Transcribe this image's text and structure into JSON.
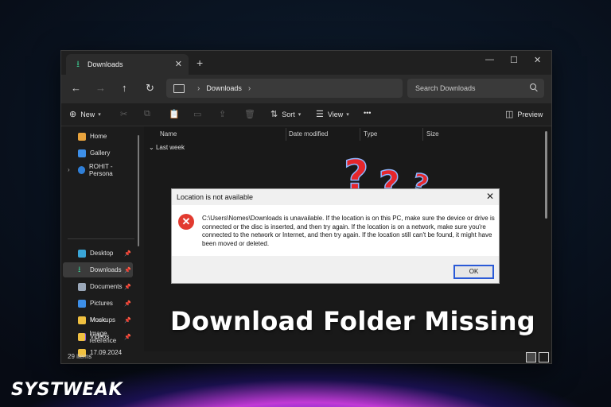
{
  "window": {
    "tab_title": "Downloads",
    "tab_close": "✕",
    "new_tab": "+",
    "controls": {
      "minimize": "—",
      "maximize": "☐",
      "close": "✕"
    }
  },
  "nav": {
    "back": "←",
    "forward": "→",
    "up": "↑",
    "refresh": "↻",
    "breadcrumb": "Downloads",
    "chevron": "›",
    "search_placeholder": "Search Downloads"
  },
  "commands": {
    "new": "New",
    "sort": "Sort",
    "view": "View",
    "more": "•••",
    "preview": "Preview"
  },
  "sidebar": {
    "items": [
      {
        "label": "Home",
        "color": "#e8a33d"
      },
      {
        "label": "Gallery",
        "color": "#3d8fe8"
      },
      {
        "label": "ROHIT - Persona",
        "color": "#2f7fd8"
      },
      {
        "label": "Desktop",
        "color": "#3aa6d8"
      },
      {
        "label": "Downloads",
        "color": "#3ac08a"
      },
      {
        "label": "Documents",
        "color": "#9aa7b8"
      },
      {
        "label": "Pictures",
        "color": "#3d8fe8"
      },
      {
        "label": "Music",
        "color": "#e06a56"
      },
      {
        "label": "Videos",
        "color": "#8a5ae0"
      },
      {
        "label": "17.09.2024",
        "color": "#f0c040"
      },
      {
        "label": "Mockups",
        "color": "#f0c040"
      },
      {
        "label": "Image reference",
        "color": "#f0c040"
      }
    ]
  },
  "columns": [
    "Name",
    "Date modified",
    "Type",
    "Size"
  ],
  "group_label": "Last week",
  "status": {
    "item_count": "29 items"
  },
  "dialog": {
    "title": "Location is not available",
    "close": "✕",
    "message": "C:\\Users\\Nomes\\Downloads is unavailable. If the location is on this PC, make sure the device or drive is connected or the disc is inserted, and then try again. If the location is on a network, make sure you're connected to the network or Internet, and then try again. If the location still can't be found, it might have been moved or deleted.",
    "ok_label": "OK",
    "error_icon": "✕"
  },
  "overlay": {
    "headline": "Download Folder Missing",
    "question_marks": "???",
    "logo": "SYSTWEAK"
  }
}
